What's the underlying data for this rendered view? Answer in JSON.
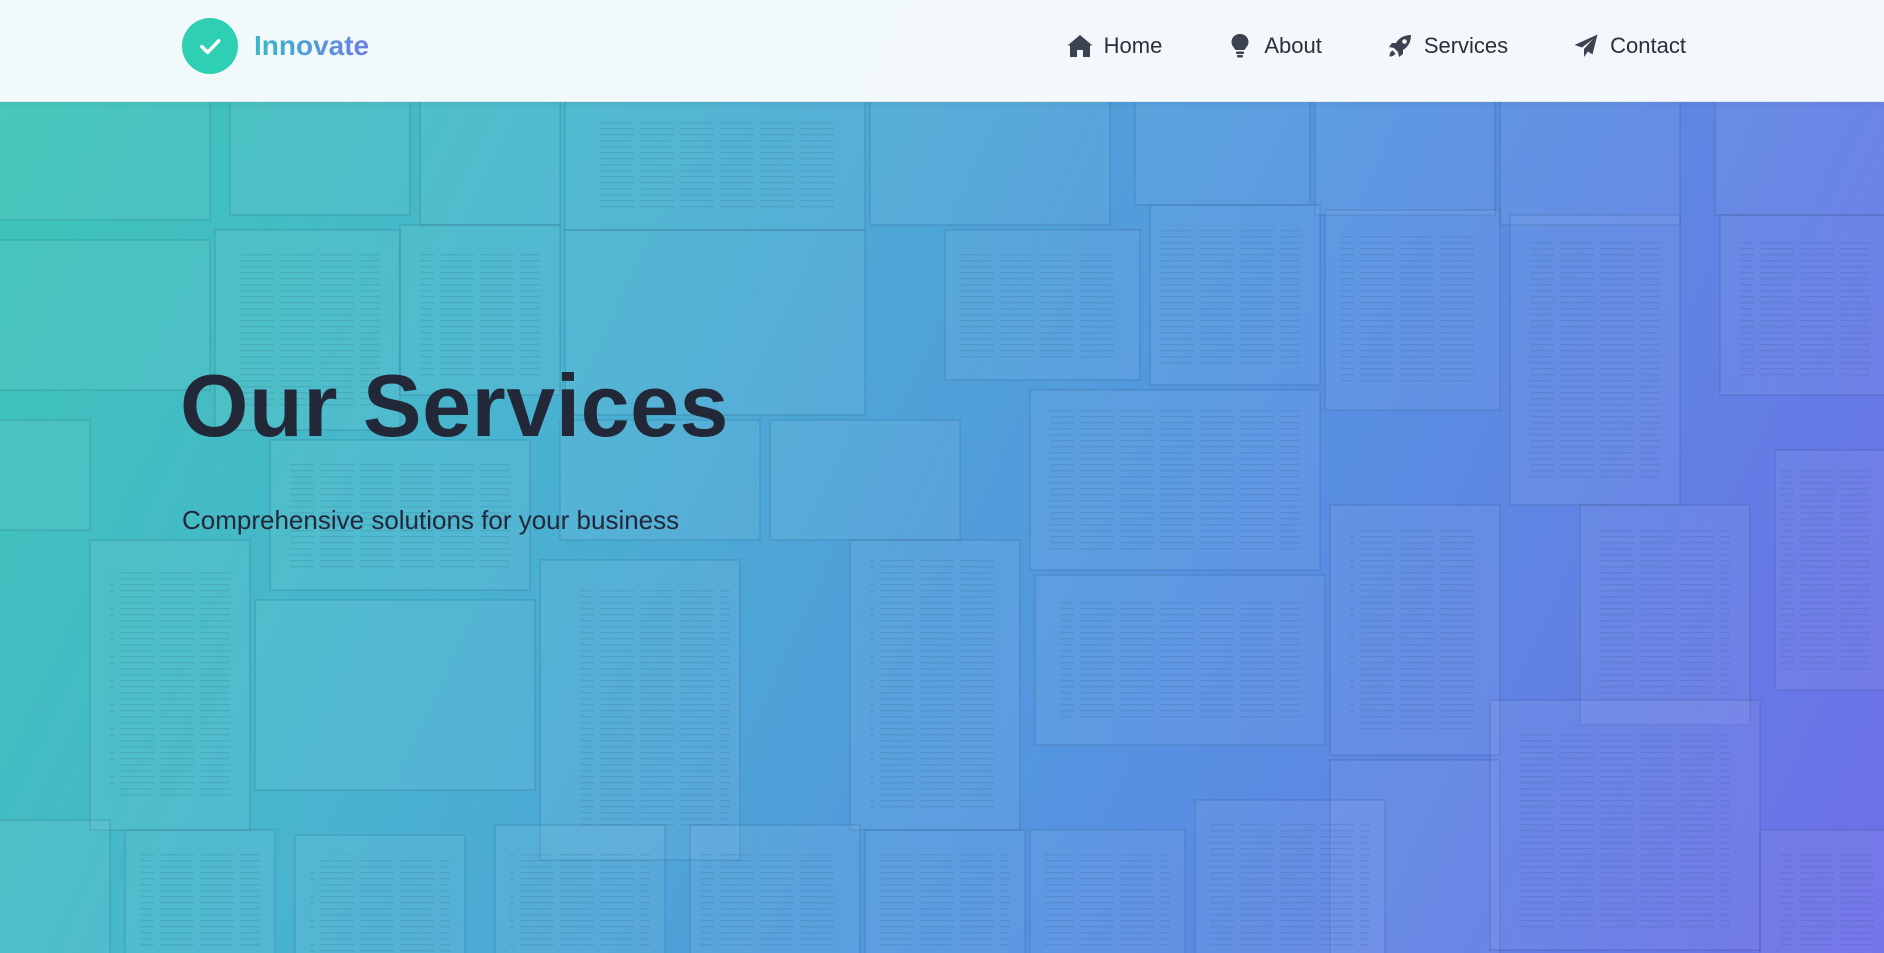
{
  "brand": {
    "name": "Innovate",
    "logo_icon": "check-icon",
    "logo_color": "#2fcfb4",
    "gradient_start": "#3bb8c9",
    "gradient_end": "#6b7ee6"
  },
  "nav": {
    "items": [
      {
        "label": "Home",
        "icon": "home-icon"
      },
      {
        "label": "About",
        "icon": "lightbulb-icon"
      },
      {
        "label": "Services",
        "icon": "rocket-icon"
      },
      {
        "label": "Contact",
        "icon": "paper-plane-icon"
      }
    ]
  },
  "hero": {
    "title": "Our Services",
    "subtitle": "Comprehensive solutions for your business",
    "background_gradient": [
      "#3cc6b4",
      "#48b4cf",
      "#5593e0",
      "#6e6ee8"
    ],
    "background_image": "open-books-collage"
  },
  "colors": {
    "text_dark": "#232838",
    "nav_text": "#2a2f3a",
    "header_bg": "#f8fbfc"
  }
}
